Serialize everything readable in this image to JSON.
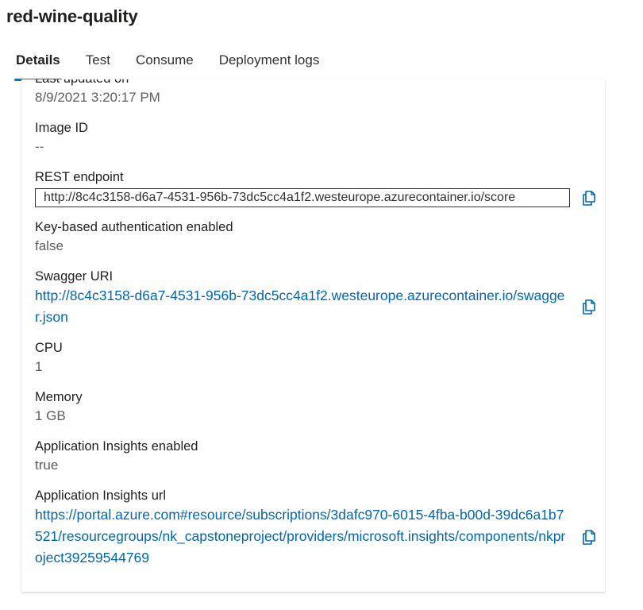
{
  "page": {
    "title": "red-wine-quality"
  },
  "tabs": [
    {
      "label": "Details",
      "active": true
    },
    {
      "label": "Test",
      "active": false
    },
    {
      "label": "Consume",
      "active": false
    },
    {
      "label": "Deployment logs",
      "active": false
    }
  ],
  "details": {
    "last_updated_label": "Last updated on",
    "last_updated_value": "8/9/2021 3:20:17 PM",
    "image_id_label": "Image ID",
    "image_id_value": "--",
    "rest_endpoint_label": "REST endpoint",
    "rest_endpoint_value": "http://8c4c3158-d6a7-4531-956b-73dc5cc4a1f2.westeurope.azurecontainer.io/score",
    "key_auth_label": "Key-based authentication enabled",
    "key_auth_value": "false",
    "swagger_label": "Swagger URI",
    "swagger_value": "http://8c4c3158-d6a7-4531-956b-73dc5cc4a1f2.westeurope.azurecontainer.io/swagger.json",
    "cpu_label": "CPU",
    "cpu_value": "1",
    "memory_label": "Memory",
    "memory_value": "1 GB",
    "app_insights_enabled_label": "Application Insights enabled",
    "app_insights_enabled_value": "true",
    "app_insights_url_label": "Application Insights url",
    "app_insights_url_value": "https://portal.azure.com#resource/subscriptions/3dafc970-6015-4fba-b00d-39dc6a1b7521/resourcegroups/nk_capstoneproject/providers/microsoft.insights/components/nkproject39259544769"
  },
  "icons": {
    "copy": "copy-icon"
  },
  "colors": {
    "accent": "#0078d4",
    "link": "#0067b8"
  }
}
